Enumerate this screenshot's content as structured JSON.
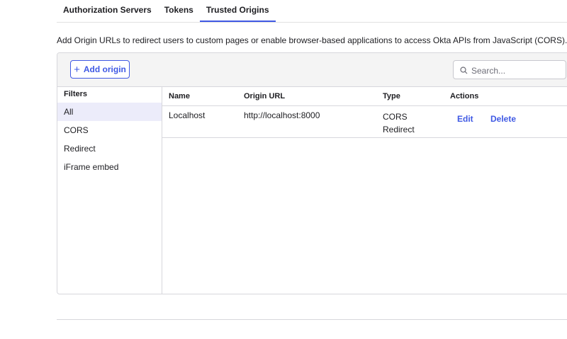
{
  "tabs": [
    {
      "label": "Authorization Servers"
    },
    {
      "label": "Tokens"
    },
    {
      "label": "Trusted Origins"
    }
  ],
  "description": "Add Origin URLs to redirect users to custom pages or enable browser-based applications to access Okta APIs from JavaScript (CORS).",
  "toolbar": {
    "add_label": "Add origin",
    "search_placeholder": "Search..."
  },
  "filters": {
    "title": "Filters",
    "items": [
      "All",
      "CORS",
      "Redirect",
      "iFrame embed"
    ]
  },
  "table": {
    "headers": [
      "Name",
      "Origin URL",
      "Type",
      "Actions"
    ],
    "rows": [
      {
        "name": "Localhost",
        "origin_url": "http://localhost:8000",
        "type": [
          "CORS",
          "Redirect"
        ],
        "actions": [
          "Edit",
          "Delete"
        ]
      }
    ]
  },
  "colors": {
    "accent": "#3f59e4",
    "active_filter_bg": "#ececfa",
    "toolbar_bg": "#f4f4f4"
  }
}
